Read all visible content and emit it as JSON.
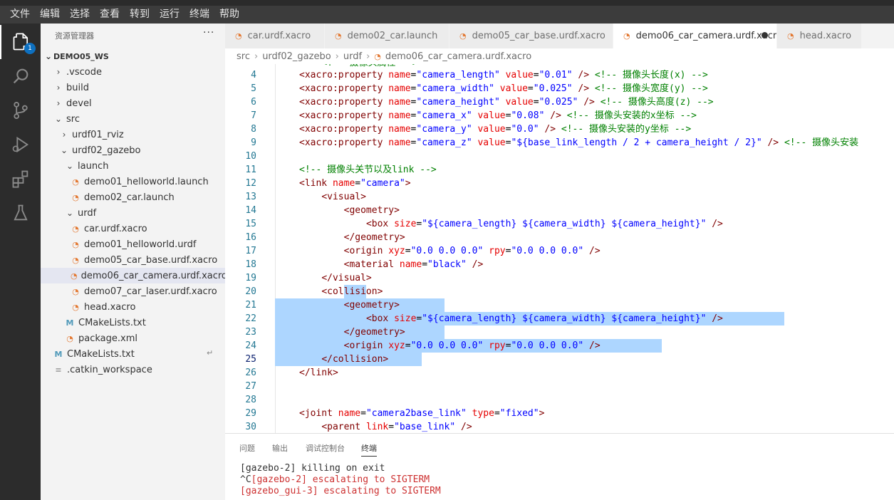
{
  "menu": [
    "文件",
    "编辑",
    "选择",
    "查看",
    "转到",
    "运行",
    "终端",
    "帮助"
  ],
  "activity": {
    "explorer_badge": "1",
    "icons": [
      "files-icon",
      "search-icon",
      "source-control-icon",
      "run-debug-icon",
      "extensions-icon",
      "testing-flask-icon"
    ]
  },
  "sidebar": {
    "title": "资源管理器",
    "more": "···",
    "root": "DEMO05_WS",
    "items": [
      {
        "label": ".vscode",
        "kind": "folder",
        "expanded": false
      },
      {
        "label": "build",
        "kind": "folder",
        "expanded": false
      },
      {
        "label": "devel",
        "kind": "folder",
        "expanded": false
      },
      {
        "label": "src",
        "kind": "folder",
        "expanded": true
      },
      {
        "label": "urdf01_rviz",
        "kind": "folder",
        "expanded": false
      },
      {
        "label": "urdf02_gazebo",
        "kind": "folder",
        "expanded": true
      },
      {
        "label": "launch",
        "kind": "folder",
        "expanded": true
      },
      {
        "label": "demo01_helloworld.launch",
        "kind": "rss"
      },
      {
        "label": "demo02_car.launch",
        "kind": "rss"
      },
      {
        "label": "urdf",
        "kind": "folder",
        "expanded": true
      },
      {
        "label": "car.urdf.xacro",
        "kind": "rss"
      },
      {
        "label": "demo01_helloworld.urdf",
        "kind": "rss"
      },
      {
        "label": "demo05_car_base.urdf.xacro",
        "kind": "rss"
      },
      {
        "label": "demo06_car_camera.urdf.xacro",
        "kind": "rss",
        "selected": true
      },
      {
        "label": "demo07_car_laser.urdf.xacro",
        "kind": "rss"
      },
      {
        "label": "head.xacro",
        "kind": "rss"
      },
      {
        "label": "CMakeLists.txt",
        "kind": "cmake"
      },
      {
        "label": "package.xml",
        "kind": "rss"
      },
      {
        "label": "CMakeLists.txt",
        "kind": "cmake"
      },
      {
        "label": ".catkin_workspace",
        "kind": "txt"
      }
    ]
  },
  "tabs": [
    {
      "label": "car.urdf.xacro",
      "active": false
    },
    {
      "label": "demo02_car.launch",
      "active": false
    },
    {
      "label": "demo05_car_base.urdf.xacro",
      "active": false
    },
    {
      "label": "demo06_car_camera.urdf.xacro",
      "active": true,
      "dirty": true
    },
    {
      "label": "head.xacro",
      "active": false
    }
  ],
  "breadcrumb": [
    "src",
    "urdf02_gazebo",
    "urdf",
    "demo06_car_camera.urdf.xacro"
  ],
  "editor": {
    "current_line": 25,
    "lines": [
      {
        "n": "4",
        "indent": 1,
        "parts": [
          [
            "tag",
            "<xacro:property "
          ],
          [
            "attr",
            "name"
          ],
          [
            "txt",
            "="
          ],
          [
            "val",
            "\"camera_length\""
          ],
          [
            "txt",
            " "
          ],
          [
            "attr",
            "value"
          ],
          [
            "txt",
            "="
          ],
          [
            "val",
            "\"0.01\""
          ],
          [
            "txt",
            " "
          ],
          [
            "tag",
            "/>"
          ],
          [
            "txt",
            " "
          ],
          [
            "com",
            "<!-- 摄像头长度(x) -->"
          ]
        ]
      },
      {
        "n": "5",
        "indent": 1,
        "parts": [
          [
            "tag",
            "<xacro:property "
          ],
          [
            "attr",
            "name"
          ],
          [
            "txt",
            "="
          ],
          [
            "val",
            "\"camera_width\""
          ],
          [
            "txt",
            " "
          ],
          [
            "attr",
            "value"
          ],
          [
            "txt",
            "="
          ],
          [
            "val",
            "\"0.025\""
          ],
          [
            "txt",
            " "
          ],
          [
            "tag",
            "/>"
          ],
          [
            "txt",
            " "
          ],
          [
            "com",
            "<!-- 摄像头宽度(y) -->"
          ]
        ]
      },
      {
        "n": "6",
        "indent": 1,
        "parts": [
          [
            "tag",
            "<xacro:property "
          ],
          [
            "attr",
            "name"
          ],
          [
            "txt",
            "="
          ],
          [
            "val",
            "\"camera_height\""
          ],
          [
            "txt",
            " "
          ],
          [
            "attr",
            "value"
          ],
          [
            "txt",
            "="
          ],
          [
            "val",
            "\"0.025\""
          ],
          [
            "txt",
            " "
          ],
          [
            "tag",
            "/>"
          ],
          [
            "txt",
            " "
          ],
          [
            "com",
            "<!-- 摄像头高度(z) -->"
          ]
        ]
      },
      {
        "n": "7",
        "indent": 1,
        "parts": [
          [
            "tag",
            "<xacro:property "
          ],
          [
            "attr",
            "name"
          ],
          [
            "txt",
            "="
          ],
          [
            "val",
            "\"camera_x\""
          ],
          [
            "txt",
            " "
          ],
          [
            "attr",
            "value"
          ],
          [
            "txt",
            "="
          ],
          [
            "val",
            "\"0.08\""
          ],
          [
            "txt",
            " "
          ],
          [
            "tag",
            "/>"
          ],
          [
            "txt",
            " "
          ],
          [
            "com",
            "<!-- 摄像头安装的x坐标 -->"
          ]
        ]
      },
      {
        "n": "8",
        "indent": 1,
        "parts": [
          [
            "tag",
            "<xacro:property "
          ],
          [
            "attr",
            "name"
          ],
          [
            "txt",
            "="
          ],
          [
            "val",
            "\"camera_y\""
          ],
          [
            "txt",
            " "
          ],
          [
            "attr",
            "value"
          ],
          [
            "txt",
            "="
          ],
          [
            "val",
            "\"0.0\""
          ],
          [
            "txt",
            " "
          ],
          [
            "tag",
            "/>"
          ],
          [
            "txt",
            " "
          ],
          [
            "com",
            "<!-- 摄像头安装的y坐标 -->"
          ]
        ]
      },
      {
        "n": "9",
        "indent": 1,
        "parts": [
          [
            "tag",
            "<xacro:property "
          ],
          [
            "attr",
            "name"
          ],
          [
            "txt",
            "="
          ],
          [
            "val",
            "\"camera_z\""
          ],
          [
            "txt",
            " "
          ],
          [
            "attr",
            "value"
          ],
          [
            "txt",
            "="
          ],
          [
            "val",
            "\"${base_link_length / 2 + camera_height / 2}\""
          ],
          [
            "txt",
            " "
          ],
          [
            "tag",
            "/>"
          ],
          [
            "txt",
            " "
          ],
          [
            "com",
            "<!-- 摄像头安装"
          ]
        ]
      },
      {
        "n": "10",
        "indent": 0,
        "parts": []
      },
      {
        "n": "11",
        "indent": 1,
        "parts": [
          [
            "com",
            "<!-- 摄像头关节以及link -->"
          ]
        ]
      },
      {
        "n": "12",
        "indent": 1,
        "parts": [
          [
            "tag",
            "<link "
          ],
          [
            "attr",
            "name"
          ],
          [
            "txt",
            "="
          ],
          [
            "val",
            "\"camera\""
          ],
          [
            "tag",
            ">"
          ]
        ]
      },
      {
        "n": "13",
        "indent": 2,
        "parts": [
          [
            "tag",
            "<visual>"
          ]
        ]
      },
      {
        "n": "14",
        "indent": 3,
        "parts": [
          [
            "tag",
            "<geometry>"
          ]
        ]
      },
      {
        "n": "15",
        "indent": 4,
        "parts": [
          [
            "tag",
            "<box "
          ],
          [
            "attr",
            "size"
          ],
          [
            "txt",
            "="
          ],
          [
            "val",
            "\"${camera_length} ${camera_width} ${camera_height}\""
          ],
          [
            "txt",
            " "
          ],
          [
            "tag",
            "/>"
          ]
        ]
      },
      {
        "n": "16",
        "indent": 3,
        "parts": [
          [
            "tag",
            "</geometry>"
          ]
        ]
      },
      {
        "n": "17",
        "indent": 3,
        "parts": [
          [
            "tag",
            "<origin "
          ],
          [
            "attr",
            "xyz"
          ],
          [
            "txt",
            "="
          ],
          [
            "val",
            "\"0.0 0.0 0.0\""
          ],
          [
            "txt",
            " "
          ],
          [
            "attr",
            "rpy"
          ],
          [
            "txt",
            "="
          ],
          [
            "val",
            "\"0.0 0.0 0.0\""
          ],
          [
            "txt",
            " "
          ],
          [
            "tag",
            "/>"
          ]
        ]
      },
      {
        "n": "18",
        "indent": 3,
        "parts": [
          [
            "tag",
            "<material "
          ],
          [
            "attr",
            "name"
          ],
          [
            "txt",
            "="
          ],
          [
            "val",
            "\"black\""
          ],
          [
            "txt",
            " "
          ],
          [
            "tag",
            "/>"
          ]
        ]
      },
      {
        "n": "19",
        "indent": 2,
        "parts": [
          [
            "tag",
            "</visual>"
          ]
        ]
      },
      {
        "n": "20",
        "indent": 2,
        "parts": [
          [
            "tag",
            "<collision>"
          ]
        ]
      },
      {
        "n": "21",
        "indent": 3,
        "parts": [
          [
            "tag",
            "<geometry>"
          ]
        ]
      },
      {
        "n": "22",
        "indent": 4,
        "parts": [
          [
            "tag",
            "<box "
          ],
          [
            "attr",
            "size"
          ],
          [
            "txt",
            "="
          ],
          [
            "val",
            "\"${camera_length} ${camera_width} ${camera_height}\""
          ],
          [
            "txt",
            " "
          ],
          [
            "tag",
            "/>"
          ]
        ]
      },
      {
        "n": "23",
        "indent": 3,
        "parts": [
          [
            "tag",
            "</geometry>"
          ]
        ]
      },
      {
        "n": "24",
        "indent": 3,
        "parts": [
          [
            "tag",
            "<origin "
          ],
          [
            "attr",
            "xyz"
          ],
          [
            "txt",
            "="
          ],
          [
            "val",
            "\"0.0 0.0 0.0\""
          ],
          [
            "txt",
            " "
          ],
          [
            "attr",
            "rpy"
          ],
          [
            "txt",
            "="
          ],
          [
            "val",
            "\"0.0 0.0 0.0\""
          ],
          [
            "txt",
            " "
          ],
          [
            "tag",
            "/>"
          ]
        ]
      },
      {
        "n": "25",
        "indent": 2,
        "parts": [
          [
            "tag",
            "</collision>"
          ]
        ]
      },
      {
        "n": "26",
        "indent": 1,
        "parts": [
          [
            "tag",
            "</link>"
          ]
        ]
      },
      {
        "n": "27",
        "indent": 0,
        "parts": []
      },
      {
        "n": "28",
        "indent": 0,
        "parts": []
      },
      {
        "n": "29",
        "indent": 1,
        "parts": [
          [
            "tag",
            "<joint "
          ],
          [
            "attr",
            "name"
          ],
          [
            "txt",
            "="
          ],
          [
            "val",
            "\"camera2base_link\""
          ],
          [
            "txt",
            " "
          ],
          [
            "attr",
            "type"
          ],
          [
            "txt",
            "="
          ],
          [
            "val",
            "\"fixed\""
          ],
          [
            "tag",
            ">"
          ]
        ]
      },
      {
        "n": "30",
        "indent": 2,
        "parts": [
          [
            "tag",
            "<parent "
          ],
          [
            "attr",
            "link"
          ],
          [
            "txt",
            "="
          ],
          [
            "val",
            "\"base_link\""
          ],
          [
            "txt",
            " "
          ],
          [
            "tag",
            "/>"
          ]
        ]
      }
    ],
    "top_partial": "<!-- 摄像头属性 -->"
  },
  "panel": {
    "tabs": [
      "问题",
      "输出",
      "调试控制台",
      "终端"
    ],
    "active_tab": "终端",
    "terminal": [
      {
        "text": "[gazebo-2] killing on exit",
        "color": "normal"
      },
      {
        "text": "^C",
        "color": "normal",
        "rest": "[gazebo-2] escalating to SIGTERM",
        "rest_color": "red"
      },
      {
        "text": "[gazebo_gui-3] escalating to SIGTERM",
        "color": "red"
      }
    ]
  },
  "colors": {
    "accent": "#0e70c0",
    "selection": "#add6ff",
    "tag": "#800000",
    "attr": "#e50000",
    "value": "#0000ff",
    "comment": "#008000"
  }
}
